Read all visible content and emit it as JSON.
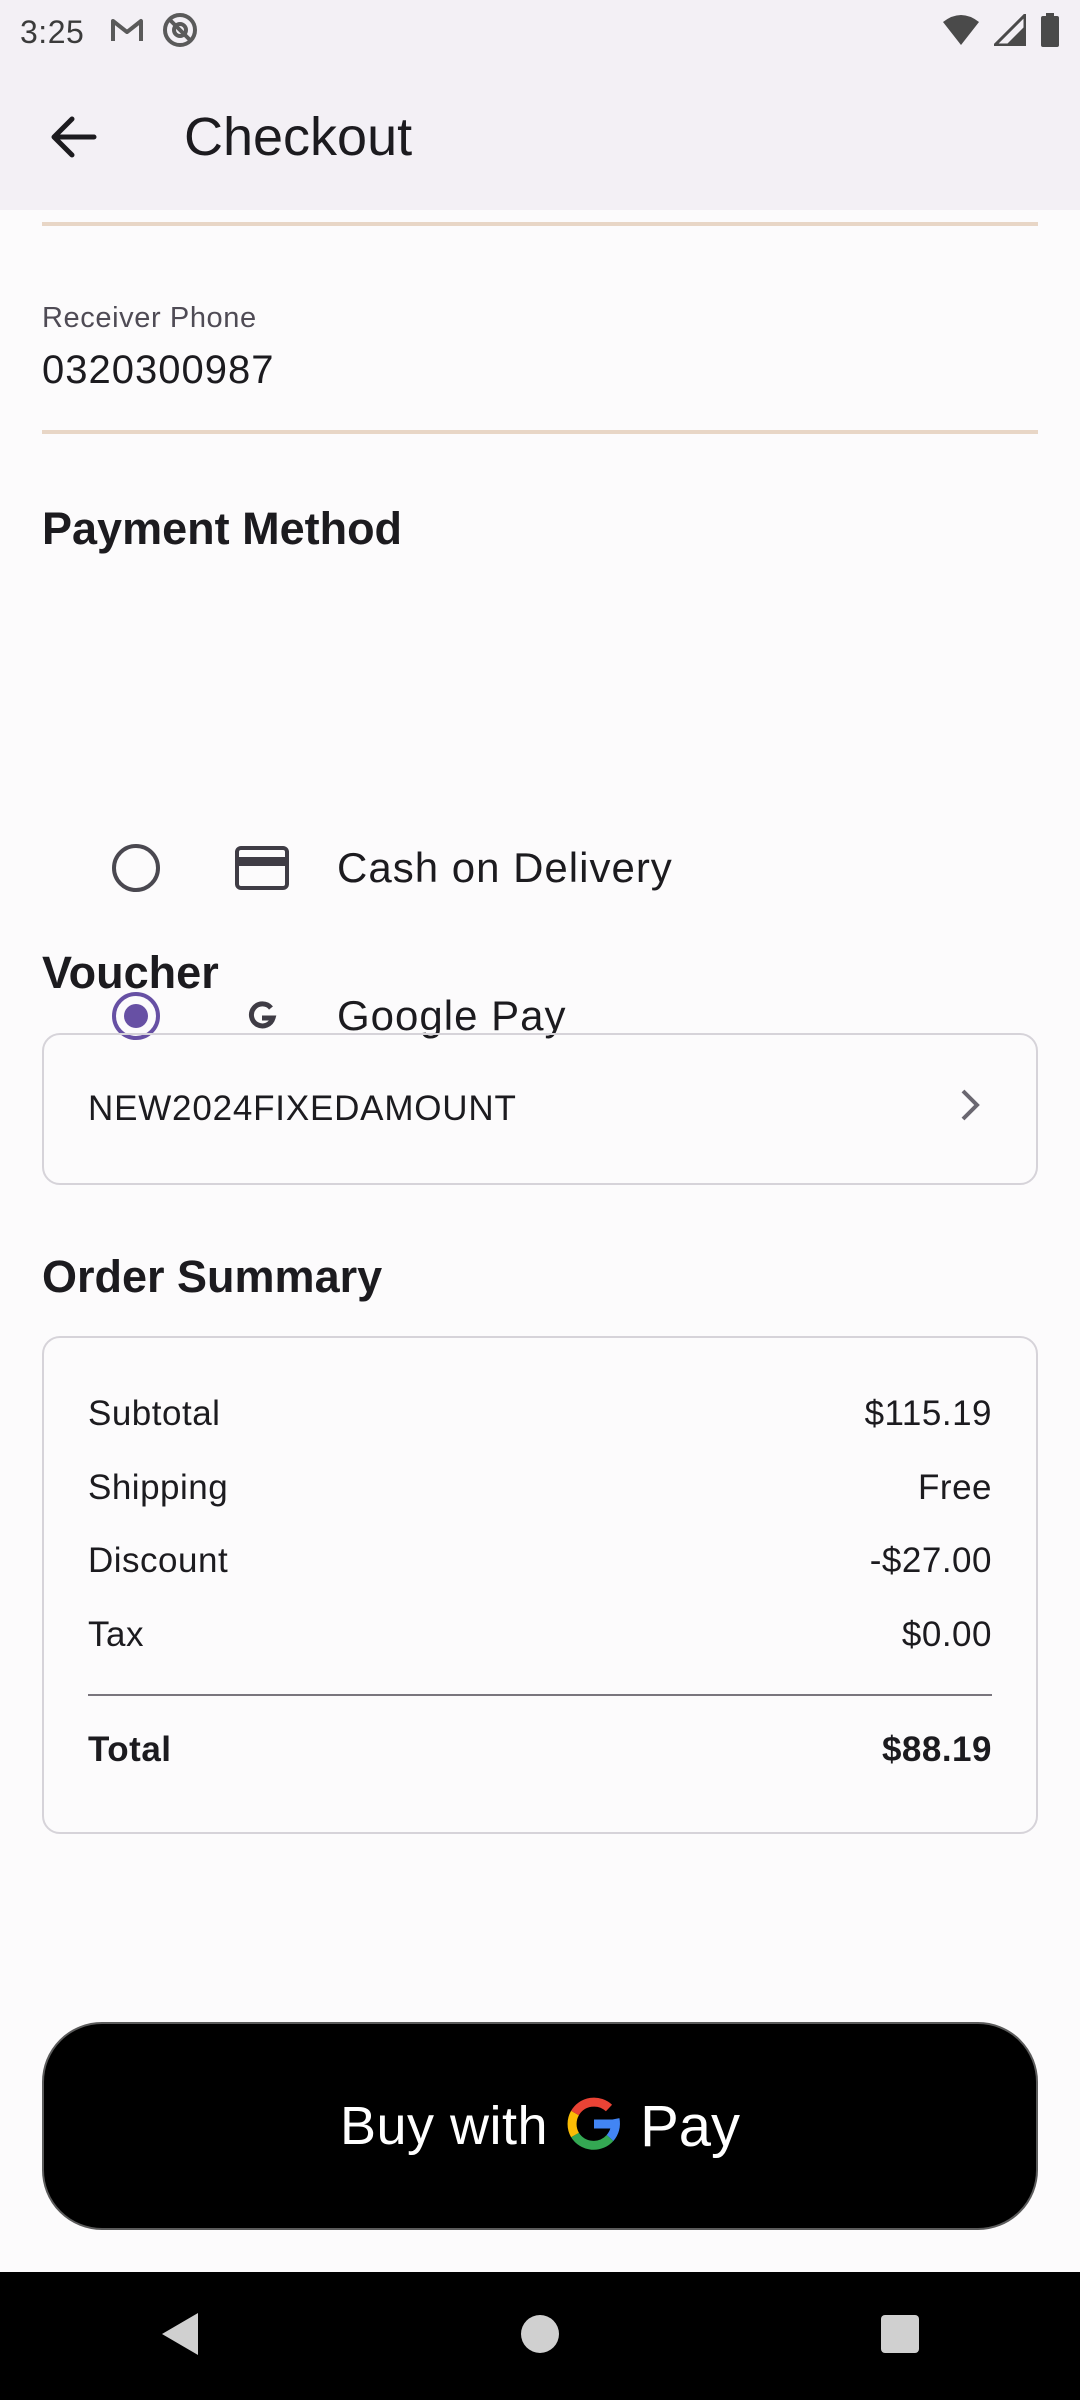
{
  "status_bar": {
    "time": "3:25",
    "left_icons": [
      "gmail-icon",
      "at-sign-icon"
    ],
    "right_icons": [
      "wifi-icon",
      "signal-icon",
      "battery-icon"
    ]
  },
  "app_bar": {
    "title": "Checkout",
    "back_icon": "arrow-back-icon"
  },
  "receiver_phone": {
    "label": "Receiver Phone",
    "value": "0320300987"
  },
  "payment_method": {
    "title": "Payment Method",
    "options": [
      {
        "label": "Cash on Delivery",
        "icon": "credit-card-icon",
        "selected": false
      },
      {
        "label": "Google Pay",
        "icon": "google-g-icon",
        "selected": true
      }
    ]
  },
  "voucher": {
    "title": "Voucher",
    "code": "NEW2024FIXEDAMOUNT"
  },
  "order_summary": {
    "title": "Order Summary",
    "rows": [
      {
        "label": "Subtotal",
        "value": "$115.19"
      },
      {
        "label": "Shipping",
        "value": "Free"
      },
      {
        "label": "Discount",
        "value": "-$27.00"
      },
      {
        "label": "Tax",
        "value": "$0.00"
      }
    ],
    "total": {
      "label": "Total",
      "value": "$88.19"
    }
  },
  "pay_button": {
    "buy_text": "Buy with",
    "pay_text": "Pay",
    "logo_letter": "G"
  },
  "colors": {
    "accent": "#6750a4",
    "appbar_bg": "#f3f0f5",
    "field_underline": "#e8d6c6",
    "button_bg": "#000000"
  }
}
